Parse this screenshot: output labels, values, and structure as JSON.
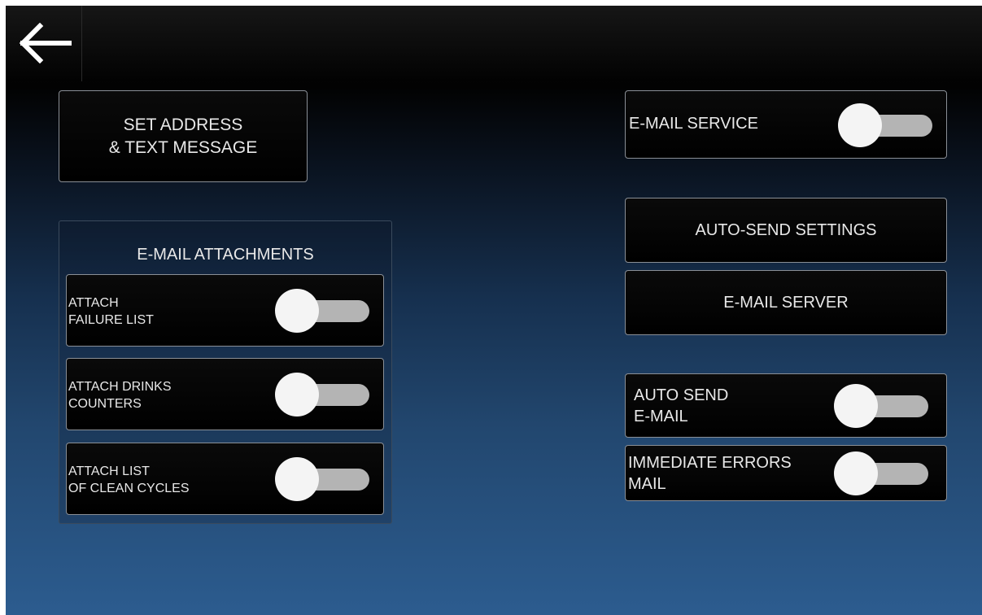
{
  "header": {
    "back_icon": "arrow-left-icon"
  },
  "buttons": {
    "set_address_line1": "SET ADDRESS",
    "set_address_line2": "& TEXT MESSAGE",
    "auto_send_settings": "AUTO-SEND SETTINGS",
    "email_server": "E-MAIL SERVER"
  },
  "attachments": {
    "title": "E-MAIL ATTACHMENTS",
    "items": [
      {
        "line1": "ATTACH",
        "line2": "FAILURE LIST",
        "on": false
      },
      {
        "line1": "ATTACH DRINKS",
        "line2": "COUNTERS",
        "on": false
      },
      {
        "line1": "ATTACH LIST",
        "line2": "OF CLEAN CYCLES",
        "on": false
      }
    ]
  },
  "email_service": {
    "label": "E-MAIL SERVICE",
    "on": false
  },
  "auto_send_email": {
    "line1": "AUTO SEND",
    "line2": "E-MAIL",
    "on": false
  },
  "immediate_errors": {
    "line1": "IMMEDIATE ERRORS",
    "line2": "MAIL",
    "on": false
  },
  "colors": {
    "switch_track": "#b4b4b4",
    "switch_knob": "#f4f4f4",
    "button_border": "#8a8f96"
  }
}
